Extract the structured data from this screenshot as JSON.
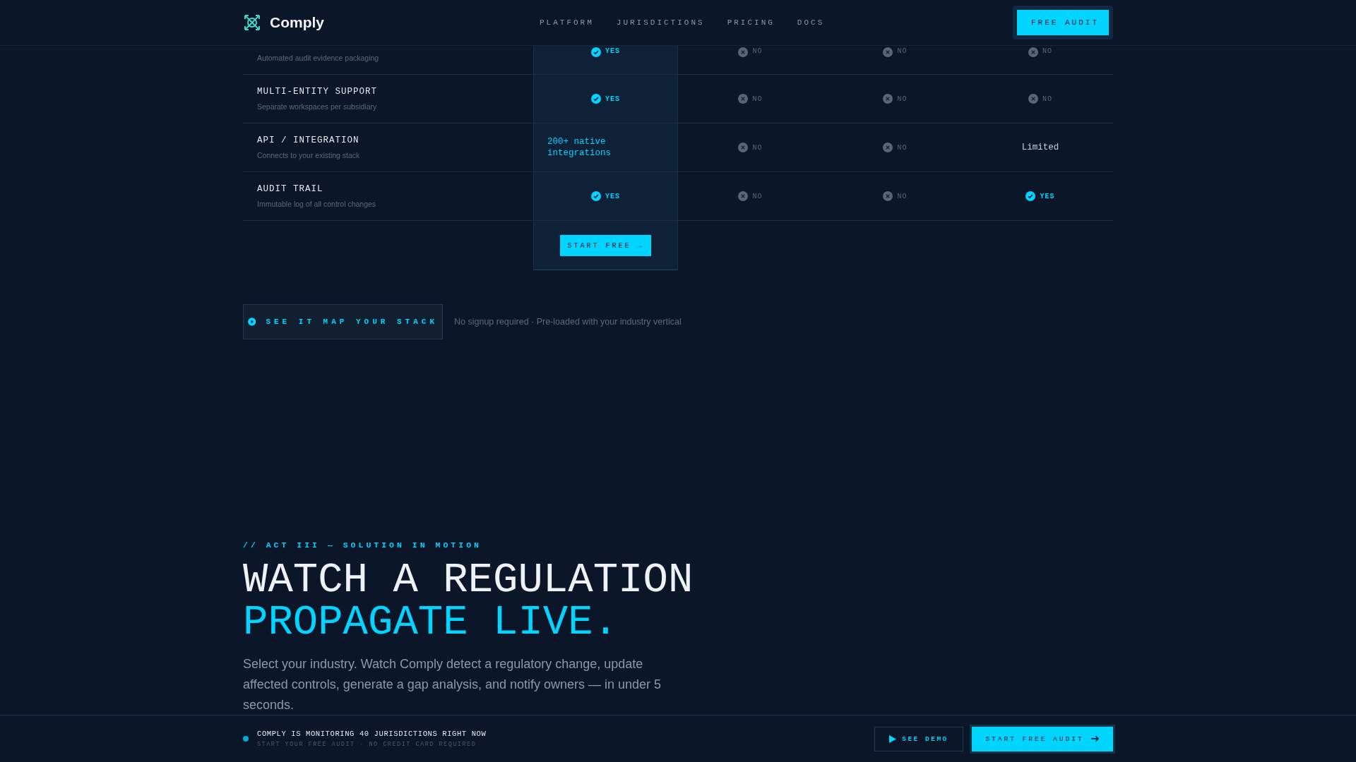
{
  "header": {
    "brand": "Comply",
    "nav": [
      "PLATFORM",
      "JURISDICTIONS",
      "PRICING",
      "DOCS"
    ],
    "cta": "FREE AUDIT"
  },
  "comparison": {
    "rows": [
      {
        "description": "Automated audit evidence packaging",
        "cells": [
          {
            "kind": "yes",
            "text": "YES"
          },
          {
            "kind": "no",
            "text": "NO"
          },
          {
            "kind": "no",
            "text": "NO"
          },
          {
            "kind": "no",
            "text": "NO"
          }
        ]
      },
      {
        "title": "MULTI-ENTITY SUPPORT",
        "description": "Separate workspaces per subsidiary",
        "cells": [
          {
            "kind": "yes",
            "text": "YES"
          },
          {
            "kind": "no",
            "text": "NO"
          },
          {
            "kind": "no",
            "text": "NO"
          },
          {
            "kind": "no",
            "text": "NO"
          }
        ]
      },
      {
        "title": "API / INTEGRATION",
        "description": "Connects to your existing stack",
        "cells": [
          {
            "kind": "highlight",
            "text": "200+ native integrations"
          },
          {
            "kind": "no",
            "text": "NO"
          },
          {
            "kind": "no",
            "text": "NO"
          },
          {
            "kind": "text",
            "text": "Limited"
          }
        ]
      },
      {
        "title": "AUDIT TRAIL",
        "description": "Immutable log of all control changes",
        "cells": [
          {
            "kind": "yes",
            "text": "YES"
          },
          {
            "kind": "no",
            "text": "NO"
          },
          {
            "kind": "no",
            "text": "NO"
          },
          {
            "kind": "yes",
            "text": "YES"
          }
        ]
      }
    ],
    "cta": "START FREE →"
  },
  "demo": {
    "button": "SEE IT MAP YOUR STACK",
    "note": "No signup required · Pre-loaded with your industry vertical"
  },
  "section": {
    "eyebrow": "// ACT III — SOLUTION IN MOTION",
    "heading_line_1": "WATCH A REGULATION",
    "heading_line_2": "PROPAGATE LIVE.",
    "body": "Select your industry. Watch Comply detect a regulatory change, update affected controls, generate a gap analysis, and notify owners — in under 5 seconds."
  },
  "sticky_bar": {
    "title": "COMPLY IS MONITORING 40 JURISDICTIONS RIGHT NOW",
    "subtitle": "START YOUR FREE AUDIT · NO CREDIT CARD REQUIRED",
    "demo_button": "SEE DEMO",
    "cta_button": "START FREE AUDIT"
  }
}
